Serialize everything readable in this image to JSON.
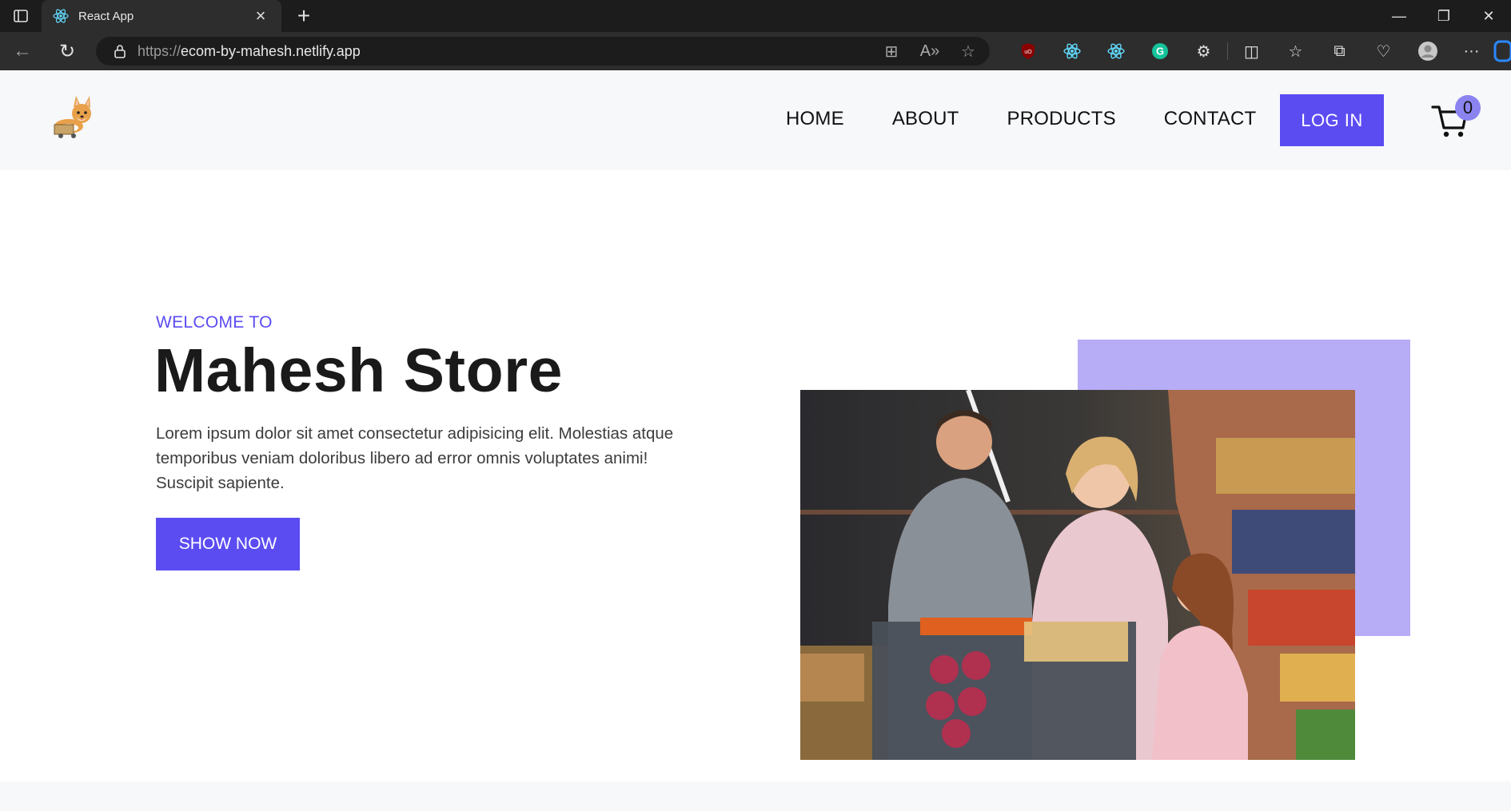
{
  "browser": {
    "tab_title": "React App",
    "url_protocol": "https://",
    "url_host": "ecom-by-mahesh.netlify.app",
    "tab_icon": "react-icon",
    "extensions": [
      "ublock-icon",
      "react-devtools-icon",
      "react-devtools-icon",
      "grammarly-icon",
      "extensions-icon",
      "split-screen-icon",
      "favorites-icon",
      "collections-icon",
      "performance-icon",
      "profile-icon",
      "more-icon",
      "bing-icon"
    ]
  },
  "header": {
    "nav": [
      "HOME",
      "ABOUT",
      "PRODUCTS",
      "CONTACT"
    ],
    "login_label": "LOG IN",
    "cart_count": "0",
    "logo_icon": "corgi-logo-icon"
  },
  "hero": {
    "welcome": "WELCOME TO",
    "title": "Mahesh Store",
    "description": "Lorem ipsum dolor sit amet consectetur adipisicing elit. Molestias atque temporibus veniam doloribus libero ad error omnis voluptates animi! Suscipit sapiente.",
    "cta_label": "SHOW NOW"
  },
  "colors": {
    "accent": "#5b4cf2",
    "accent_light": "#b7acf6",
    "header_bg": "#f6f8fa"
  }
}
